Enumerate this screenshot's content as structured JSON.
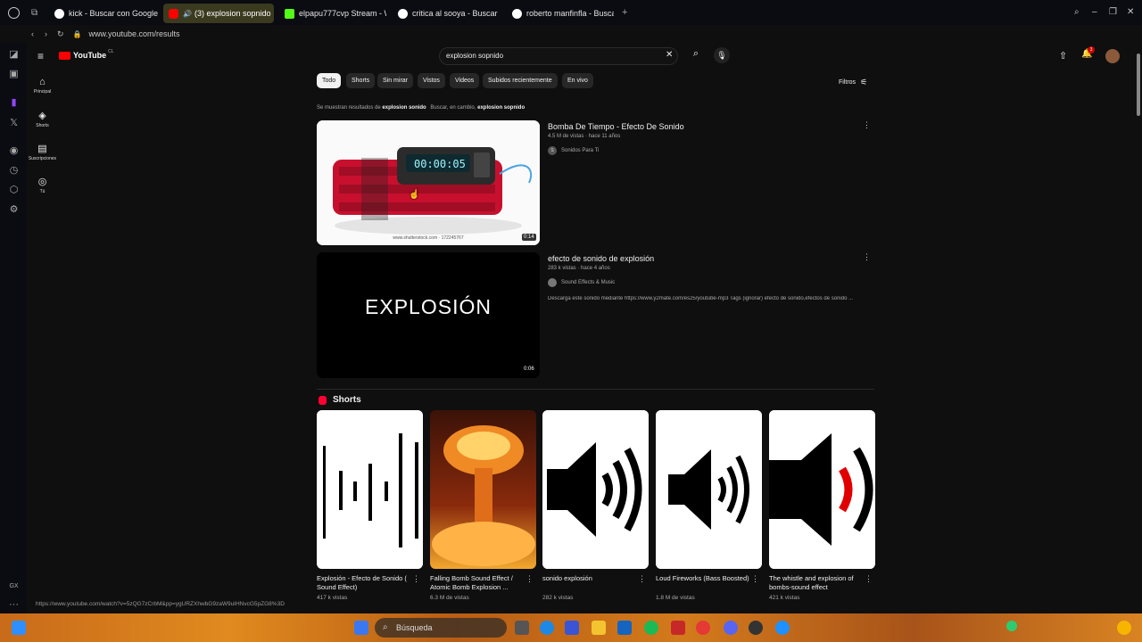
{
  "browser": {
    "tabs": [
      {
        "label": "kick - Buscar con Google",
        "fav_color": "#ffffff"
      },
      {
        "label": "(3) explosion sopnido",
        "fav_color": "#ff0000"
      },
      {
        "label": "elpapu777cvp Stream - W",
        "fav_color": "#53fc18"
      },
      {
        "label": "critica al sooya - Buscar c",
        "fav_color": "#ffffff"
      },
      {
        "label": "roberto manfinfla - Busca",
        "fav_color": "#ffffff"
      }
    ],
    "url": "www.youtube.com/results"
  },
  "youtube": {
    "logo_text": "YouTube",
    "country": "CL",
    "search_value": "explosion sopnido",
    "nav": [
      {
        "label": "Principal",
        "icon": "home-icon"
      },
      {
        "label": "Shorts",
        "icon": "shorts-icon"
      },
      {
        "label": "Suscripciones",
        "icon": "subscriptions-icon"
      },
      {
        "label": "Tú",
        "icon": "you-icon"
      }
    ],
    "chips": [
      "Todo",
      "Shorts",
      "Sin mirar",
      "Vistos",
      "Videos",
      "Subidos recientemente",
      "En vivo"
    ],
    "filters_label": "Filtros",
    "correction": {
      "prefix": "Se muestran resultados de",
      "corrected": "explosion sonido",
      "alt_prefix": "Buscar, en cambio,",
      "original": "explosion sopnido"
    },
    "videos": [
      {
        "title": "Bomba De Tiempo - Efecto De Sonido",
        "meta": "4.5 M de vistas · hace 11 años",
        "channel": "Sonidos Para Ti",
        "channel_initial": "S",
        "duration": "0:14",
        "timer": "00:00:05",
        "watermark": "www.shutterstock.com · 172245767",
        "desc": ""
      },
      {
        "title": "efecto de sonido de explosión",
        "meta": "283 k vistas · hace 4 años",
        "channel": "Sound Effects & Music",
        "channel_initial": "",
        "duration": "0:06",
        "thumb_text": "EXPLOSIÓN",
        "desc": "Descarga este sonido mediante https://www.y2mate.com/es25/youtube-mp3 Tags (ignorar) efecto de sonido,efectos de sonido ..."
      }
    ],
    "shorts_header": "Shorts",
    "shorts": [
      {
        "title": "Explosión - Efecto de Sonido ( Sound Effect)",
        "views": "417 k vistas"
      },
      {
        "title": "Falling Bomb Sound Effect / Atomic Bomb Explosion ...",
        "views": "6.3 M de vistas"
      },
      {
        "title": "sonido explosión",
        "views": "282 k vistas"
      },
      {
        "title": "Loud Fireworks (Bass Boosted)",
        "views": "1.8 M de vistas"
      },
      {
        "title": "The whistle and explosion of bombs-sound effect",
        "views": "421 k vistas"
      }
    ]
  },
  "status_url": "https://www.youtube.com/watch?v=5zQG7zCrbM&pp=ygURZXhwbG9zaW9uIHNvcG5pZG8%3D",
  "opera_gx_label": "GX",
  "taskbar": {
    "search_placeholder": "Búsqueda"
  }
}
